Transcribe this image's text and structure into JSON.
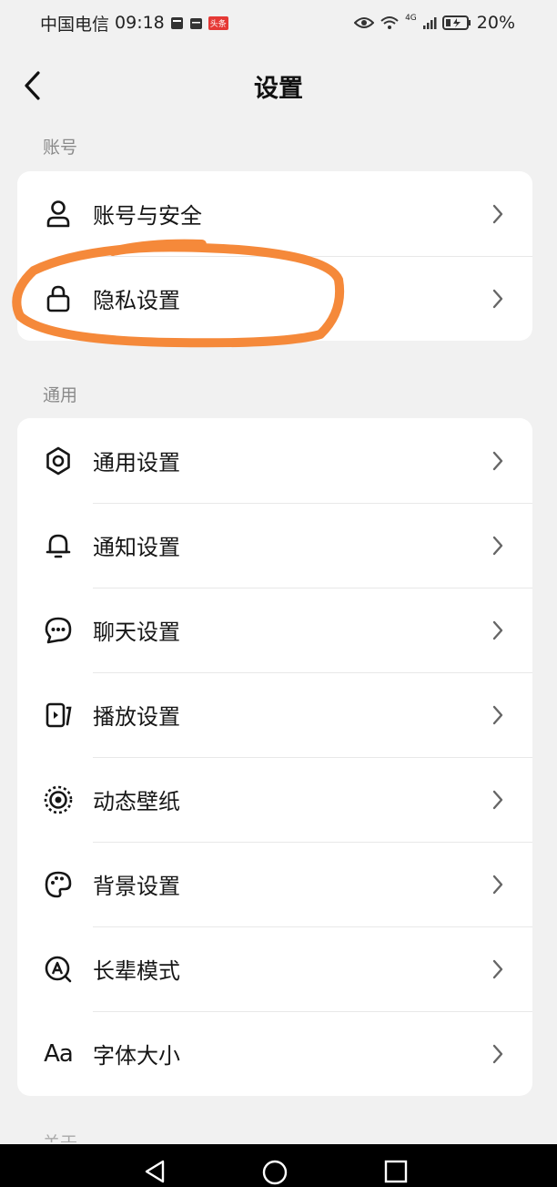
{
  "status_bar": {
    "carrier": "中国电信",
    "time": "09:18",
    "app_badge": "头条",
    "network": "4G",
    "battery": "20%"
  },
  "header": {
    "title": "设置",
    "back_icon": "chevron-left-icon"
  },
  "sections": {
    "account": {
      "label": "账号",
      "items": [
        {
          "label": "账号与安全",
          "icon": "user-icon"
        },
        {
          "label": "隐私设置",
          "icon": "lock-icon"
        }
      ]
    },
    "general": {
      "label": "通用",
      "items": [
        {
          "label": "通用设置",
          "icon": "gear-icon"
        },
        {
          "label": "通知设置",
          "icon": "bell-icon"
        },
        {
          "label": "聊天设置",
          "icon": "chat-bubble-icon"
        },
        {
          "label": "播放设置",
          "icon": "play-screen-icon"
        },
        {
          "label": "动态壁纸",
          "icon": "live-wallpaper-icon"
        },
        {
          "label": "背景设置",
          "icon": "palette-icon"
        },
        {
          "label": "长辈模式",
          "icon": "elder-mode-icon"
        },
        {
          "label": "字体大小",
          "icon": "font-size-icon",
          "icon_text": "Aa"
        }
      ]
    },
    "next_section_partial": {
      "label": "关于"
    }
  },
  "colors": {
    "background": "#f1f1f1",
    "card": "#ffffff",
    "highlight_stroke": "#f5893a",
    "nav_bar": "#000000"
  },
  "annotation": {
    "type": "hand-drawn circle",
    "target": "隐私设置"
  }
}
